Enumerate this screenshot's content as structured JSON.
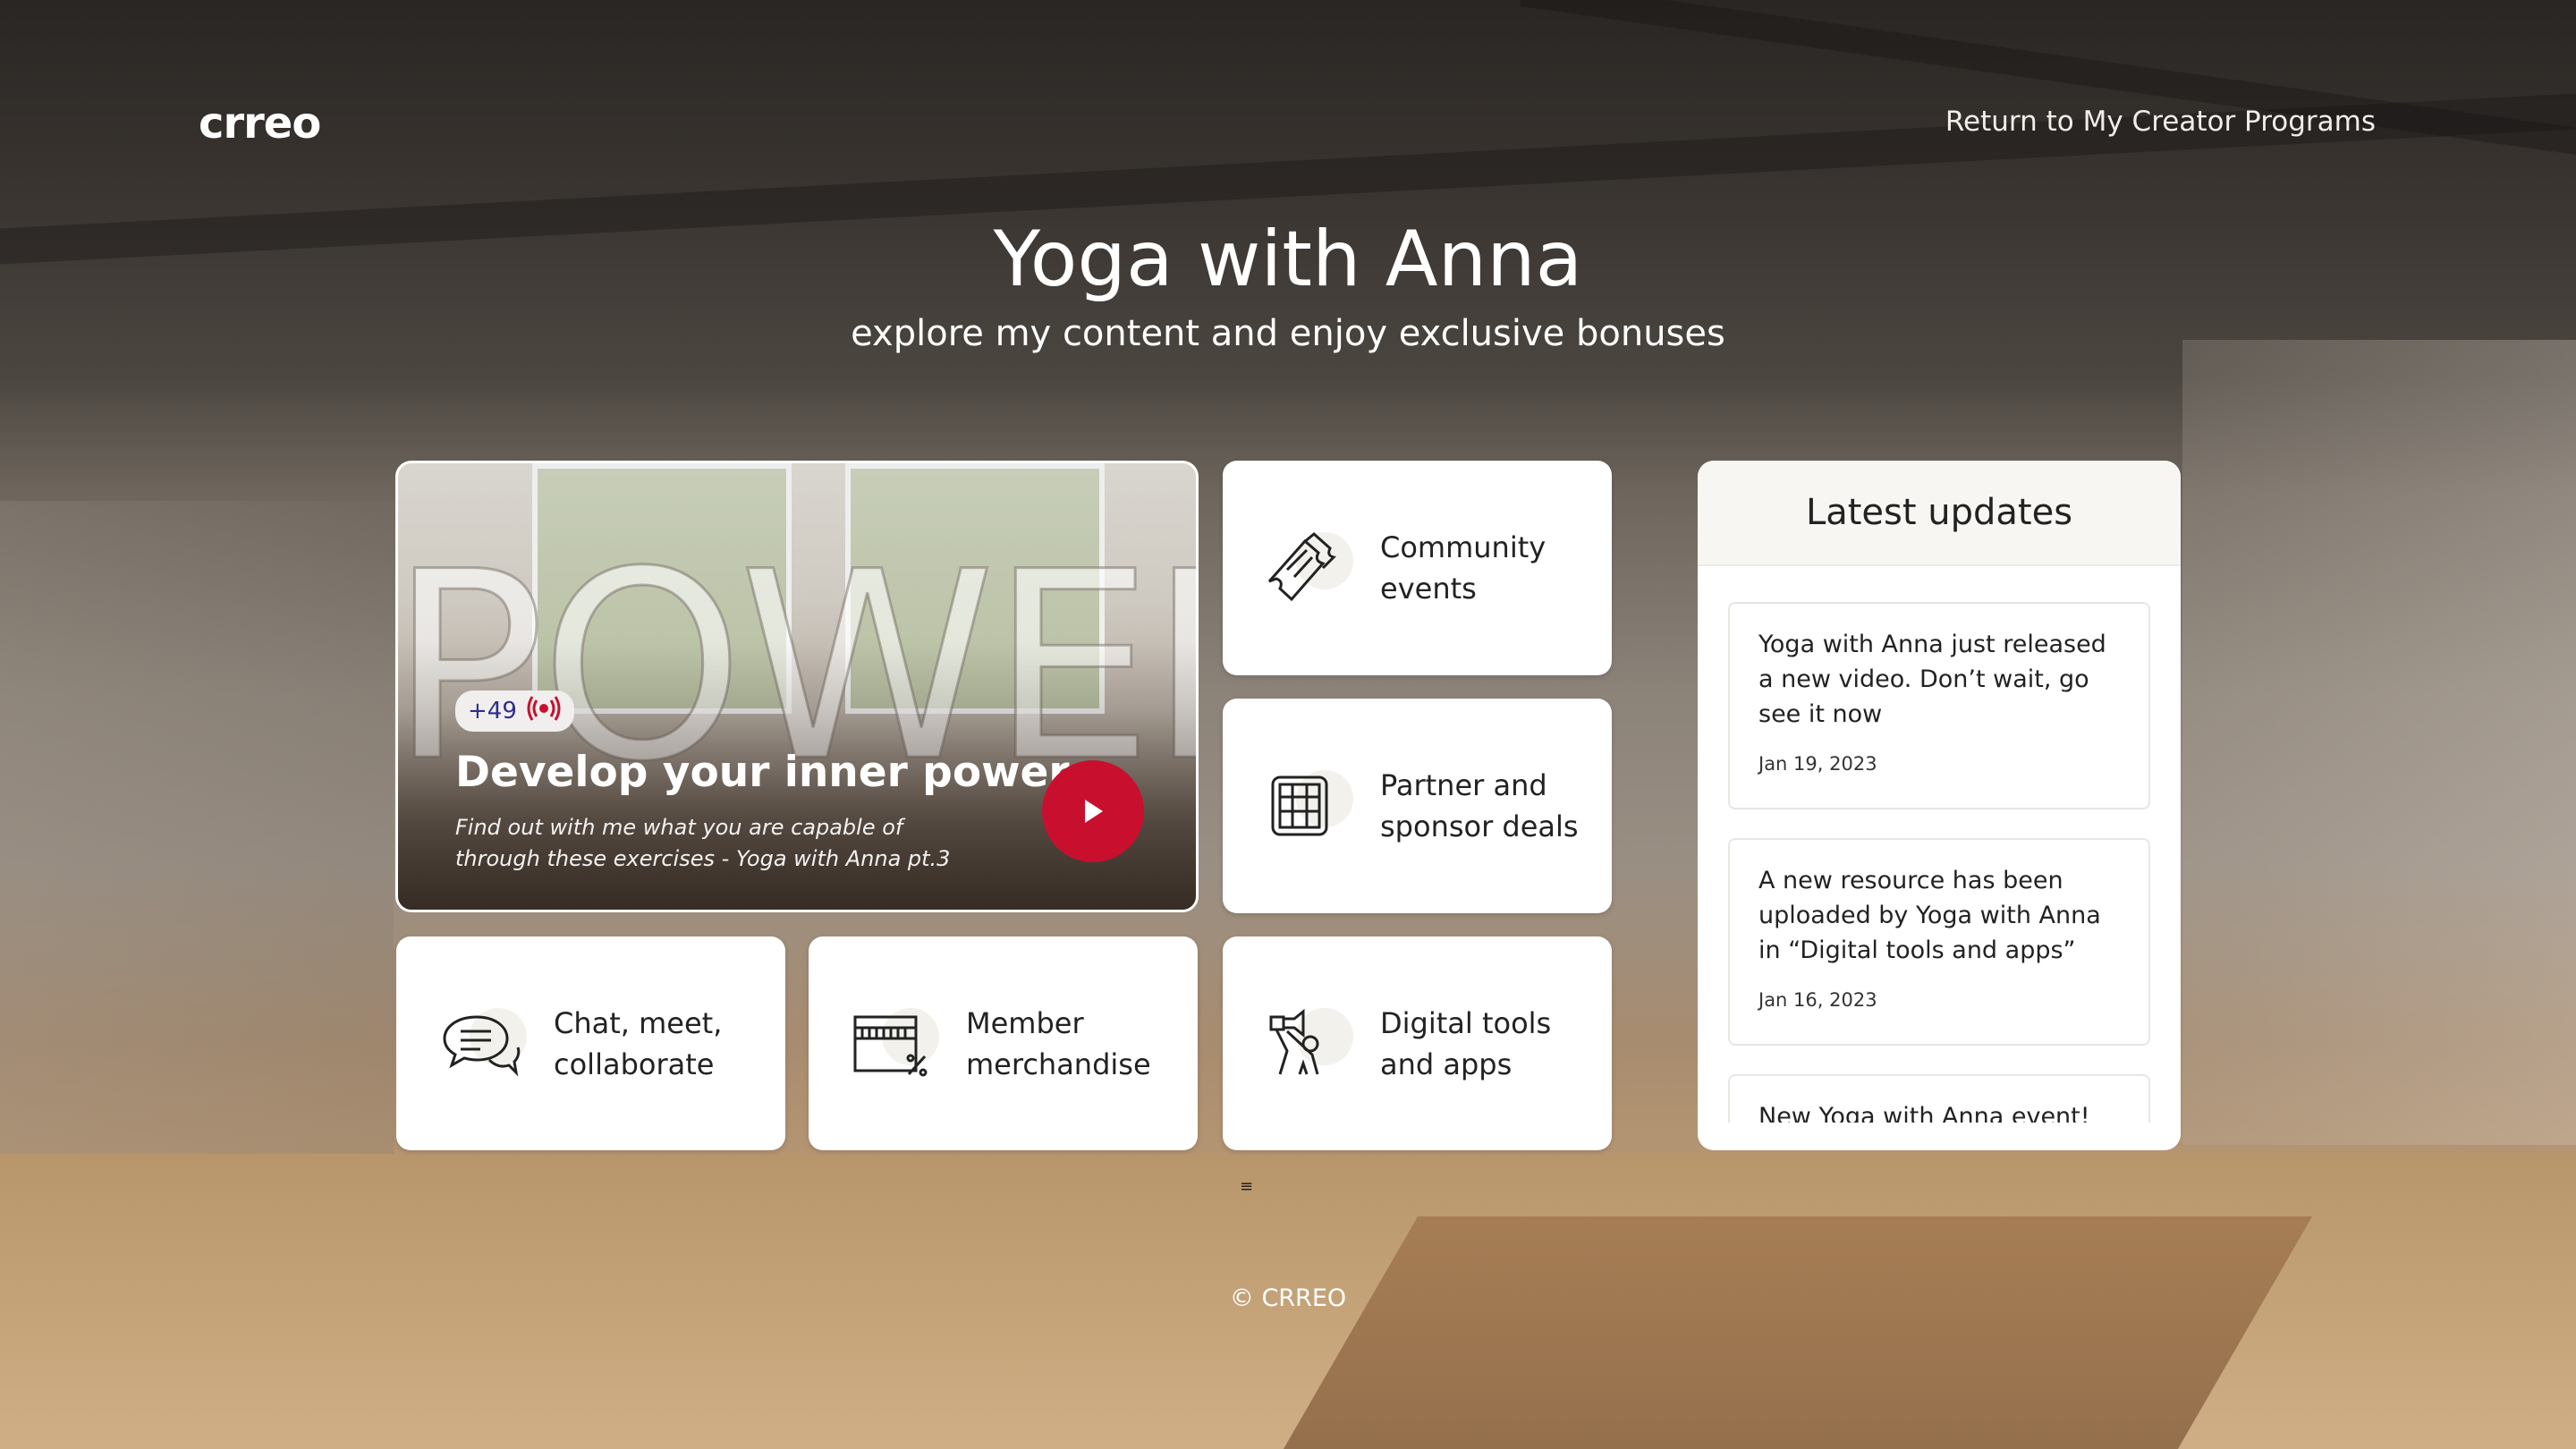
{
  "header": {
    "logo_text": "crreo",
    "return_link": "Return to My Creator Programs"
  },
  "hero_section": {
    "title": "Yoga with Anna",
    "subtitle": "explore my content and enjoy exclusive bonuses"
  },
  "featured_video": {
    "background_word": "POWER",
    "viewer_count": "+49",
    "live_icon": "live-broadcast-icon",
    "title": "Develop your inner power",
    "description": "Find out with me what you are capable of through these exercises - Yoga with Anna pt.3",
    "play_icon": "play-icon",
    "accent_color": "#c8102e"
  },
  "tiles": [
    {
      "label": "Community events",
      "icon": "tickets-icon"
    },
    {
      "label": "Partner and sponsor deals",
      "icon": "storefront-icon"
    },
    {
      "label": "Chat, meet, collaborate",
      "icon": "chat-bubbles-icon"
    },
    {
      "label": "Member merchandise",
      "icon": "shop-discount-icon"
    },
    {
      "label": "Digital tools and apps",
      "icon": "person-camera-icon"
    }
  ],
  "updates": {
    "title": "Latest updates",
    "items": [
      {
        "text": "Yoga with Anna just released a new video. Don’t wait, go see it now",
        "date": "Jan 19, 2023"
      },
      {
        "text": "A new resource has been uploaded by Yoga with Anna in “Digital tools and apps”",
        "date": "Jan 16, 2023"
      },
      {
        "text": "New Yoga with Anna event!",
        "date": ""
      }
    ]
  },
  "footer": {
    "copyright": "© CRREO"
  }
}
